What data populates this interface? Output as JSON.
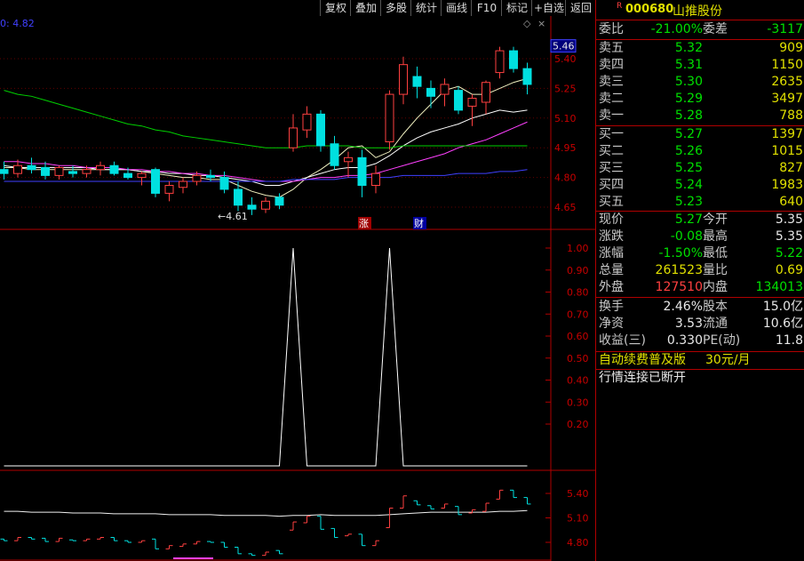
{
  "toolbar": {
    "buttons": [
      "复权",
      "叠加",
      "多股",
      "统计",
      "画线",
      "F10",
      "标记",
      "+自选",
      "返回"
    ]
  },
  "stock": {
    "marker": "R",
    "code": "000680",
    "name": "山推股份"
  },
  "chart_labels": {
    "top_left": "0: 4.82",
    "current_price_tag": "5.46",
    "low_mark": "←4.61",
    "zhang_badge": "涨",
    "cai_badge": "财"
  },
  "orderbook": {
    "weibi_label": "委比",
    "weibi_value": "-21.00%",
    "weicha_label": "委差",
    "weicha_value": "-3117",
    "sell": [
      {
        "label": "卖五",
        "price": "5.32",
        "qty": "909"
      },
      {
        "label": "卖四",
        "price": "5.31",
        "qty": "1150"
      },
      {
        "label": "卖三",
        "price": "5.30",
        "qty": "2635"
      },
      {
        "label": "卖二",
        "price": "5.29",
        "qty": "3497"
      },
      {
        "label": "卖一",
        "price": "5.28",
        "qty": "788"
      }
    ],
    "buy": [
      {
        "label": "买一",
        "price": "5.27",
        "qty": "1397"
      },
      {
        "label": "买二",
        "price": "5.26",
        "qty": "1015"
      },
      {
        "label": "买三",
        "price": "5.25",
        "qty": "827"
      },
      {
        "label": "买四",
        "price": "5.24",
        "qty": "1983"
      },
      {
        "label": "买五",
        "price": "5.23",
        "qty": "640"
      }
    ]
  },
  "stats": [
    {
      "l1": "现价",
      "v1": "5.27",
      "l2": "今开",
      "v2": "5.35",
      "c1": "g",
      "c2": "w"
    },
    {
      "l1": "涨跌",
      "v1": "-0.08",
      "l2": "最高",
      "v2": "5.35",
      "c1": "g",
      "c2": "w"
    },
    {
      "l1": "涨幅",
      "v1": "-1.50%",
      "l2": "最低",
      "v2": "5.22",
      "c1": "g",
      "c2": "g"
    },
    {
      "l1": "总量",
      "v1": "261523",
      "l2": "量比",
      "v2": "0.69",
      "c1": "y",
      "c2": "y"
    },
    {
      "l1": "外盘",
      "v1": "127510",
      "l2": "内盘",
      "v2": "134013",
      "c1": "r",
      "c2": "g"
    },
    {
      "l1": "换手",
      "v1": "2.46%",
      "l2": "股本",
      "v2": "15.0亿",
      "c1": "w",
      "c2": "w"
    },
    {
      "l1": "净资",
      "v1": "3.53",
      "l2": "流通",
      "v2": "10.6亿",
      "c1": "w",
      "c2": "w"
    },
    {
      "l1": "收益(三)",
      "v1": "0.330",
      "l2": "PE(动)",
      "v2": "11.8",
      "c1": "w",
      "c2": "w"
    }
  ],
  "promo": {
    "text": "自动续费普及版",
    "price": "30元/月"
  },
  "status": {
    "text": "行情连接已断开"
  },
  "chart_data": {
    "type": "candlestick",
    "main_axis_ticks": [
      "5.40",
      "5.25",
      "5.10",
      "4.95",
      "4.80",
      "4.65"
    ],
    "indicator_axis_ticks": [
      "1.00",
      "0.90",
      "0.80",
      "0.70",
      "0.60",
      "0.50",
      "0.40",
      "0.30",
      "0.20"
    ],
    "bottom_axis_ticks": [
      "5.40",
      "5.10",
      "4.80"
    ],
    "candles": [
      [
        4.84,
        4.88,
        4.79,
        4.82
      ],
      [
        4.82,
        4.89,
        4.8,
        4.86
      ],
      [
        4.86,
        4.9,
        4.82,
        4.84
      ],
      [
        4.85,
        4.88,
        4.79,
        4.81
      ],
      [
        4.81,
        4.86,
        4.79,
        4.85
      ],
      [
        4.83,
        4.86,
        4.8,
        4.82
      ],
      [
        4.82,
        4.86,
        4.8,
        4.84
      ],
      [
        4.84,
        4.88,
        4.81,
        4.86
      ],
      [
        4.86,
        4.88,
        4.81,
        4.82
      ],
      [
        4.82,
        4.85,
        4.79,
        4.8
      ],
      [
        4.8,
        4.83,
        4.76,
        4.82
      ],
      [
        4.84,
        4.85,
        4.7,
        4.72
      ],
      [
        4.72,
        4.78,
        4.68,
        4.76
      ],
      [
        4.75,
        4.8,
        4.72,
        4.78
      ],
      [
        4.78,
        4.83,
        4.76,
        4.81
      ],
      [
        4.81,
        4.84,
        4.78,
        4.8
      ],
      [
        4.8,
        4.83,
        4.72,
        4.74
      ],
      [
        4.74,
        4.78,
        4.63,
        4.66
      ],
      [
        4.66,
        4.7,
        4.61,
        4.64
      ],
      [
        4.64,
        4.7,
        4.62,
        4.68
      ],
      [
        4.7,
        4.72,
        4.64,
        4.66
      ],
      [
        4.95,
        5.12,
        4.93,
        5.05
      ],
      [
        5.04,
        5.16,
        5.0,
        5.12
      ],
      [
        5.12,
        5.14,
        4.93,
        4.96
      ],
      [
        4.97,
        5.01,
        4.84,
        4.86
      ],
      [
        4.88,
        4.93,
        4.8,
        4.9
      ],
      [
        4.9,
        4.94,
        4.7,
        4.76
      ],
      [
        4.76,
        4.86,
        4.72,
        4.82
      ],
      [
        4.98,
        5.24,
        4.94,
        5.22
      ],
      [
        5.22,
        5.41,
        5.17,
        5.37
      ],
      [
        5.31,
        5.36,
        5.2,
        5.26
      ],
      [
        5.25,
        5.29,
        5.15,
        5.21
      ],
      [
        5.22,
        5.3,
        5.16,
        5.27
      ],
      [
        5.24,
        5.26,
        5.12,
        5.14
      ],
      [
        5.16,
        5.22,
        5.06,
        5.2
      ],
      [
        5.18,
        5.29,
        5.12,
        5.28
      ],
      [
        5.33,
        5.46,
        5.3,
        5.44
      ],
      [
        5.44,
        5.46,
        5.33,
        5.35
      ],
      [
        5.35,
        5.38,
        5.22,
        5.27
      ]
    ],
    "ma": [
      {
        "name": "MA5",
        "color": "#f0f0c0",
        "values": [
          4.85,
          4.85,
          4.84,
          4.84,
          4.84,
          4.84,
          4.84,
          4.84,
          4.84,
          4.84,
          4.83,
          4.82,
          4.81,
          4.8,
          4.8,
          4.79,
          4.79,
          4.76,
          4.73,
          4.71,
          4.7,
          4.74,
          4.8,
          4.84,
          4.89,
          4.95,
          4.96,
          4.9,
          4.93,
          5.02,
          5.1,
          5.17,
          5.24,
          5.26,
          5.22,
          5.22,
          5.25,
          5.28,
          5.3
        ]
      },
      {
        "name": "MA10",
        "color": "#ffffff",
        "values": [
          4.86,
          4.85,
          4.85,
          4.85,
          4.85,
          4.85,
          4.85,
          4.84,
          4.84,
          4.84,
          4.83,
          4.83,
          4.82,
          4.82,
          4.81,
          4.81,
          4.8,
          4.79,
          4.78,
          4.76,
          4.76,
          4.78,
          4.8,
          4.82,
          4.84,
          4.85,
          4.85,
          4.87,
          4.91,
          4.96,
          5.0,
          5.03,
          5.05,
          5.07,
          5.1,
          5.12,
          5.14,
          5.13,
          5.14
        ]
      },
      {
        "name": "MA20",
        "color": "#ff40ff",
        "values": [
          4.88,
          4.88,
          4.87,
          4.87,
          4.86,
          4.86,
          4.85,
          4.85,
          4.85,
          4.84,
          4.84,
          4.83,
          4.83,
          4.82,
          4.82,
          4.81,
          4.81,
          4.8,
          4.79,
          4.78,
          4.78,
          4.78,
          4.79,
          4.8,
          4.8,
          4.81,
          4.81,
          4.82,
          4.84,
          4.86,
          4.88,
          4.9,
          4.92,
          4.95,
          4.97,
          4.99,
          5.02,
          5.05,
          5.08
        ]
      },
      {
        "name": "MA30",
        "color": "#00d000",
        "values": [
          5.24,
          5.22,
          5.21,
          5.19,
          5.17,
          5.15,
          5.13,
          5.11,
          5.09,
          5.07,
          5.06,
          5.04,
          5.03,
          5.01,
          5.0,
          4.99,
          4.98,
          4.97,
          4.96,
          4.95,
          4.95,
          4.95,
          4.96,
          4.96,
          4.96,
          4.96,
          4.95,
          4.95,
          4.95,
          4.96,
          4.96,
          4.96,
          4.96,
          4.96,
          4.96,
          4.96,
          4.96,
          4.96,
          4.96
        ]
      },
      {
        "name": "MA60",
        "color": "#4040ff",
        "values": [
          4.78,
          4.78,
          4.78,
          4.78,
          4.78,
          4.78,
          4.78,
          4.78,
          4.78,
          4.78,
          4.78,
          4.78,
          4.78,
          4.78,
          4.78,
          4.78,
          4.78,
          4.78,
          4.78,
          4.78,
          4.78,
          4.79,
          4.79,
          4.79,
          4.79,
          4.8,
          4.8,
          4.8,
          4.8,
          4.81,
          4.81,
          4.81,
          4.81,
          4.82,
          4.82,
          4.82,
          4.83,
          4.83,
          4.84
        ]
      }
    ],
    "signal": [
      0,
      0,
      0,
      0,
      0,
      0,
      0,
      0,
      0,
      0,
      0,
      0,
      0,
      0,
      0,
      0,
      0,
      0,
      0,
      0,
      0,
      1,
      0,
      0,
      0,
      0,
      0,
      0,
      1,
      0,
      0,
      0,
      0,
      0,
      0,
      0,
      0,
      0,
      0
    ],
    "bottom_ma": [
      5.18,
      5.18,
      5.17,
      5.17,
      5.17,
      5.16,
      5.16,
      5.16,
      5.15,
      5.15,
      5.15,
      5.15,
      5.14,
      5.14,
      5.14,
      5.14,
      5.13,
      5.13,
      5.13,
      5.13,
      5.12,
      5.13,
      5.13,
      5.14,
      5.13,
      5.13,
      5.13,
      5.13,
      5.14,
      5.15,
      5.16,
      5.17,
      5.17,
      5.17,
      5.17,
      5.17,
      5.18,
      5.18,
      5.19
    ]
  }
}
